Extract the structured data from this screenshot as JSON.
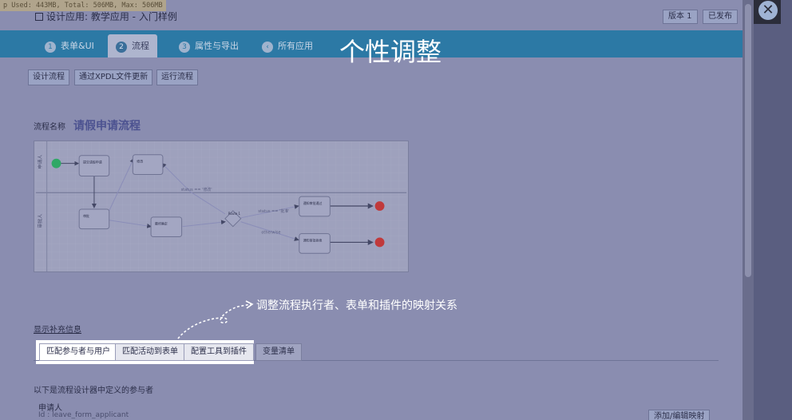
{
  "memory": "p Used: 443MB, Total: 506MB, Max: 506MB",
  "app_header": "设计应用: 教学应用 - 入门样例",
  "header_buttons": {
    "version": "版本 1",
    "published": "已发布"
  },
  "steps": [
    {
      "num": "1",
      "label": "表单&UI"
    },
    {
      "num": "2",
      "label": "流程"
    },
    {
      "num": "3",
      "label": "属性与导出"
    },
    {
      "num": "",
      "label": "所有应用"
    }
  ],
  "overlay_title": "个性调整",
  "actions": {
    "design": "设计流程",
    "xpdl": "通过XPDL文件更新",
    "run": "运行流程"
  },
  "process": {
    "label": "流程名称",
    "name": "请假申请流程"
  },
  "diagram": {
    "lane_top": "申请人",
    "lane_bottom": "审批人",
    "nodes": {
      "submit": "提交请假申请",
      "revise": "修改",
      "approve": "审批",
      "finalize": "最终确定",
      "route": "Route 1",
      "approved": "通知审批通过",
      "rejected": "通知审批拒绝"
    },
    "edges": {
      "revise": "status == '修改'",
      "approved": "status == '批准'",
      "rejected": "otherwise"
    }
  },
  "annotation": "调整流程执行者、表单和插件的映射关系",
  "more_info": "显示补充信息",
  "mapping_tabs": [
    "匹配参与者与用户",
    "匹配活动到表单",
    "配置工具到插件",
    "变量清单"
  ],
  "participants": {
    "description": "以下是流程设计器中定义的参与者",
    "name": "申请人",
    "id": "Id : leave_form_applicant",
    "add_mapping": "添加/编辑映射"
  },
  "colors": {
    "tabbar": "#2c79a5",
    "overlay_text": "#ffffff",
    "end_node": "#c0393b",
    "start_node": "#2fa866"
  }
}
